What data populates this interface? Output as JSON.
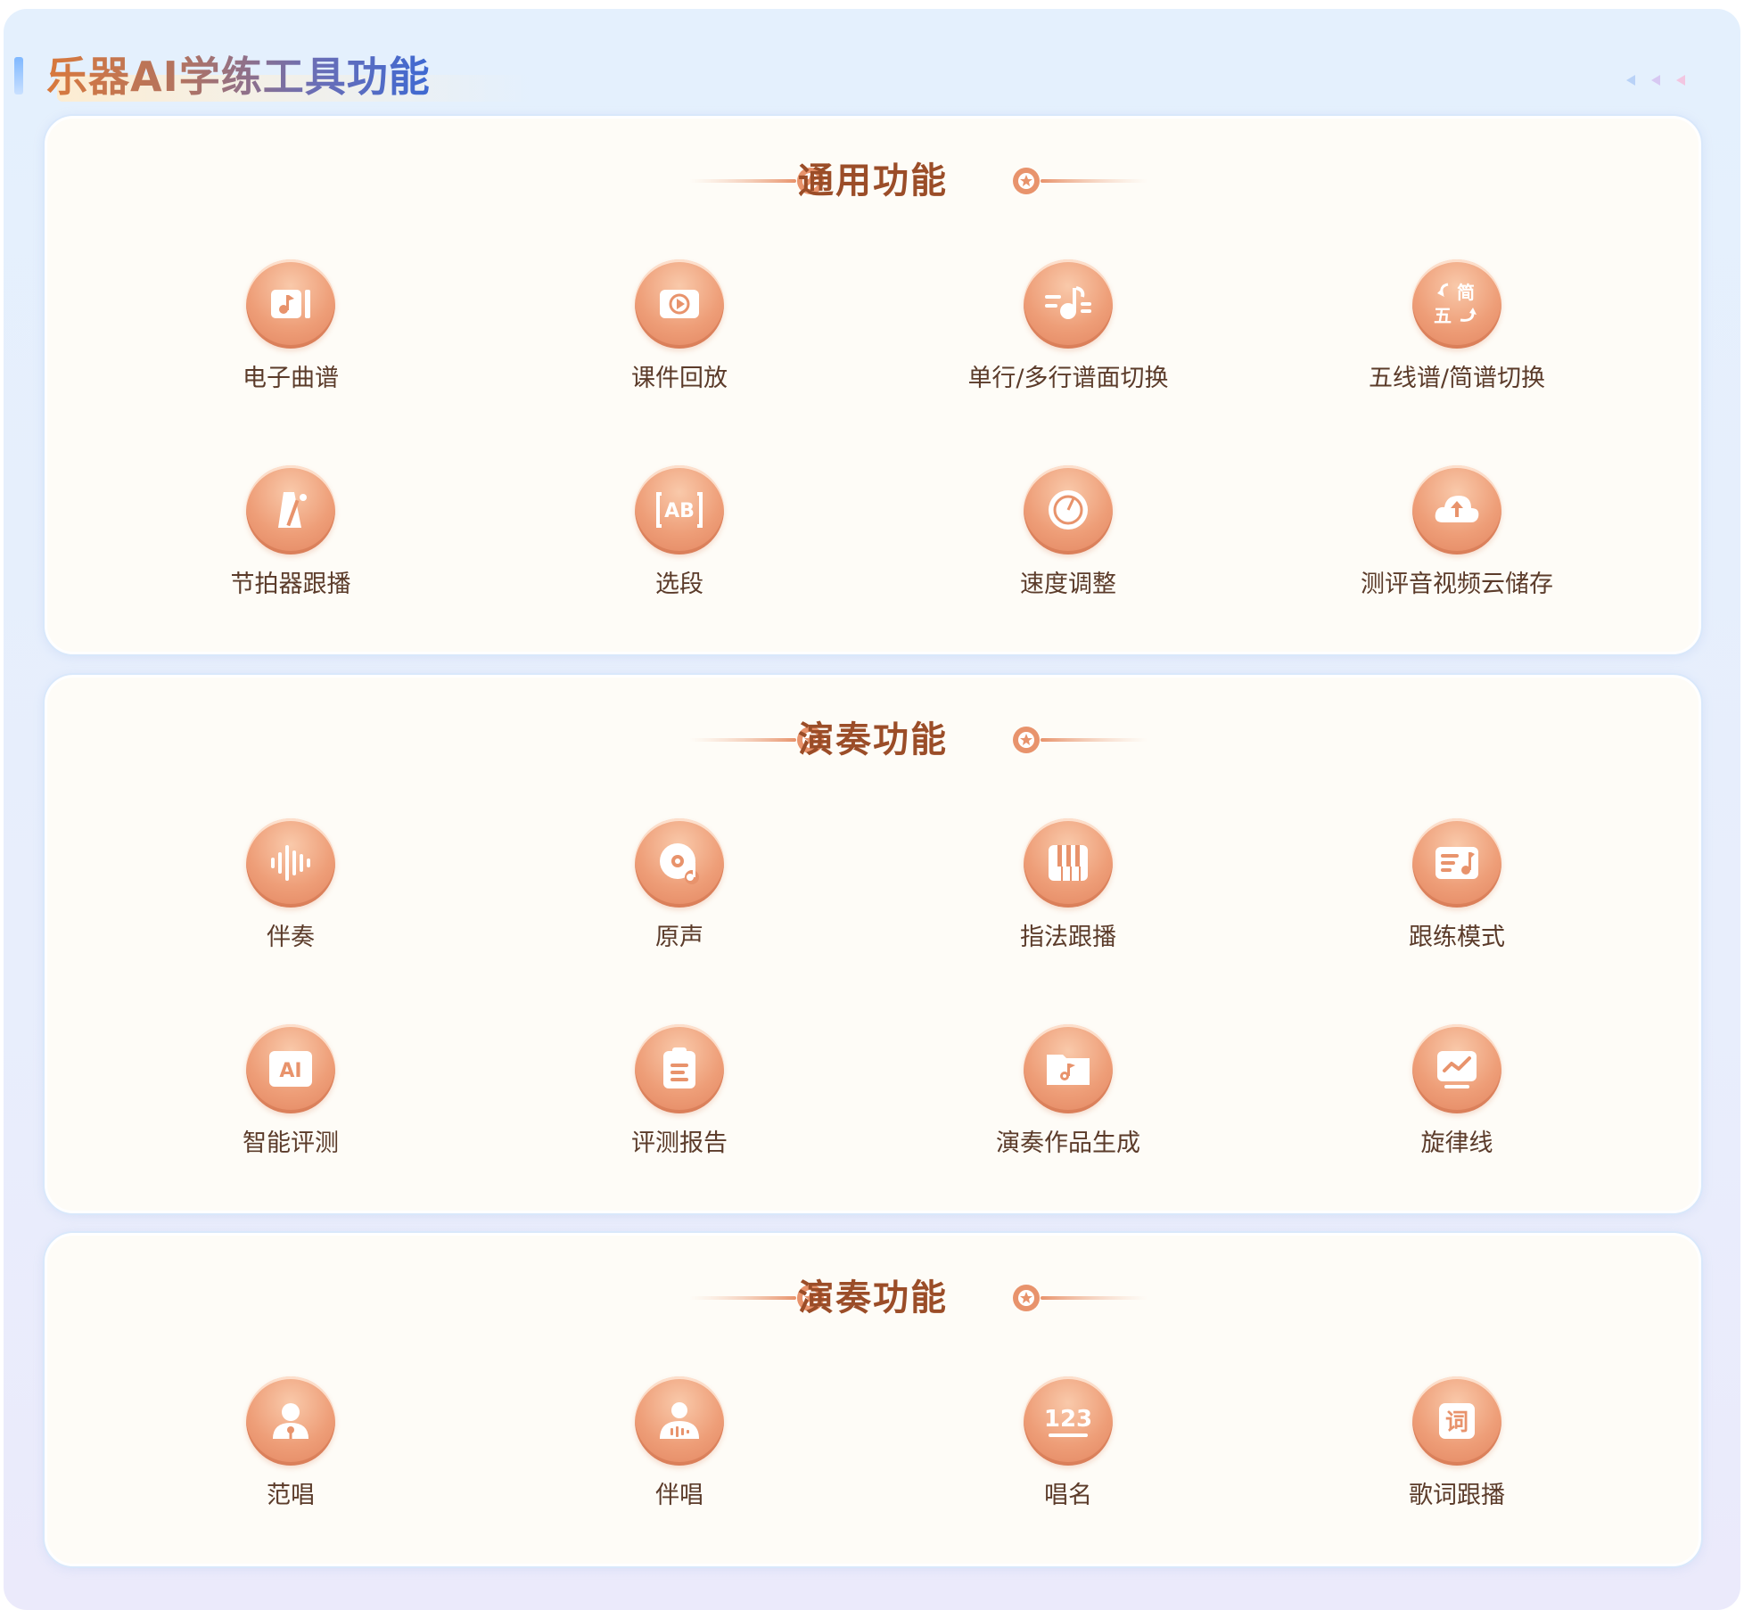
{
  "page": {
    "title": "乐器AI学练工具功能"
  },
  "sections": [
    {
      "title": "通用功能",
      "items": [
        {
          "label": "电子曲谱",
          "icon": "music-sheet-icon"
        },
        {
          "label": "课件回放",
          "icon": "replay-icon"
        },
        {
          "label": "单行/多行谱面切换",
          "icon": "line-switch-icon"
        },
        {
          "label": "五线谱/简谱切换",
          "icon": "notation-switch-icon"
        },
        {
          "label": "节拍器跟播",
          "icon": "metronome-icon"
        },
        {
          "label": "选段",
          "icon": "ab-section-icon"
        },
        {
          "label": "速度调整",
          "icon": "speedometer-icon"
        },
        {
          "label": "测评音视频云储存",
          "icon": "cloud-upload-icon"
        }
      ]
    },
    {
      "title": "演奏功能",
      "items": [
        {
          "label": "伴奏",
          "icon": "waveform-icon"
        },
        {
          "label": "原声",
          "icon": "vinyl-icon"
        },
        {
          "label": "指法跟播",
          "icon": "piano-keys-icon"
        },
        {
          "label": "跟练模式",
          "icon": "playlist-icon"
        },
        {
          "label": "智能评测",
          "icon": "ai-icon"
        },
        {
          "label": "评测报告",
          "icon": "clipboard-icon"
        },
        {
          "label": "演奏作品生成",
          "icon": "music-folder-icon"
        },
        {
          "label": "旋律线",
          "icon": "trend-chart-icon"
        }
      ]
    },
    {
      "title": "演奏功能",
      "items": [
        {
          "label": "范唱",
          "icon": "singer-icon"
        },
        {
          "label": "伴唱",
          "icon": "chorus-singer-icon"
        },
        {
          "label": "唱名",
          "icon": "solfege-123-icon"
        },
        {
          "label": "歌词跟播",
          "icon": "lyrics-icon"
        }
      ]
    }
  ],
  "icon_text": {
    "jian": "简",
    "wu": "五",
    "ab": "AB",
    "ai": "AI",
    "num": "123",
    "ci": "词"
  },
  "colors": {
    "accent": "#e8936c",
    "title_brown": "#9b4d28",
    "label": "#5b3b2a",
    "panel_bg": "#fefcf7"
  }
}
